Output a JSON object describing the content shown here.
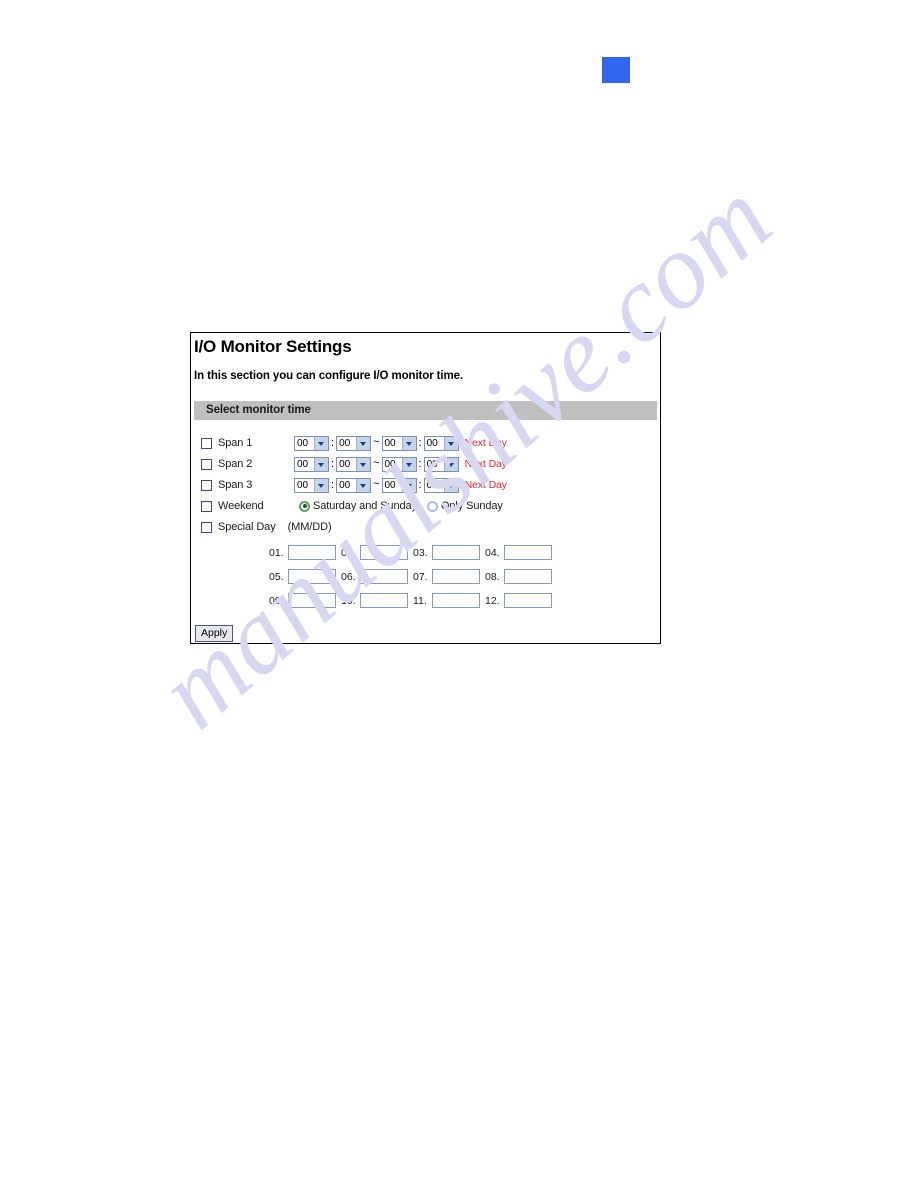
{
  "page": {
    "marker_color": "#3366f0",
    "watermark": "manualshive.com"
  },
  "panel": {
    "title": "I/O Monitor Settings",
    "description": "In this section you can configure I/O monitor time.",
    "section_bar_label": "Select monitor time",
    "apply_label": "Apply",
    "accent_red": "#e8262d",
    "section_bar_color": "#bfbfbf"
  },
  "spans": [
    {
      "label": "Span 1",
      "checked": false,
      "start_hour": "00",
      "start_minute": "00",
      "end_hour": "00",
      "end_minute": "00",
      "next_day_label": "Next Day"
    },
    {
      "label": "Span 2",
      "checked": false,
      "start_hour": "00",
      "start_minute": "00",
      "end_hour": "00",
      "end_minute": "00",
      "next_day_label": "Next Day"
    },
    {
      "label": "Span 3",
      "checked": false,
      "start_hour": "00",
      "start_minute": "00",
      "end_hour": "00",
      "end_minute": "00",
      "next_day_label": "Next Day"
    }
  ],
  "separators": {
    "colon": ":",
    "tilde": "~"
  },
  "weekend": {
    "label": "Weekend",
    "checked": false,
    "options": [
      {
        "label": "Saturday and Sunday",
        "selected": true
      },
      {
        "label": "Only Sunday",
        "selected": false
      }
    ]
  },
  "special_day": {
    "label": "Special Day",
    "checked": false,
    "format_hint": "(MM/DD)",
    "entries": [
      {
        "num": "01.",
        "value": ""
      },
      {
        "num": "02.",
        "value": ""
      },
      {
        "num": "03.",
        "value": ""
      },
      {
        "num": "04.",
        "value": ""
      },
      {
        "num": "05.",
        "value": ""
      },
      {
        "num": "06.",
        "value": ""
      },
      {
        "num": "07.",
        "value": ""
      },
      {
        "num": "08.",
        "value": ""
      },
      {
        "num": "09.",
        "value": ""
      },
      {
        "num": "10.",
        "value": ""
      },
      {
        "num": "11.",
        "value": ""
      },
      {
        "num": "12.",
        "value": ""
      }
    ]
  }
}
